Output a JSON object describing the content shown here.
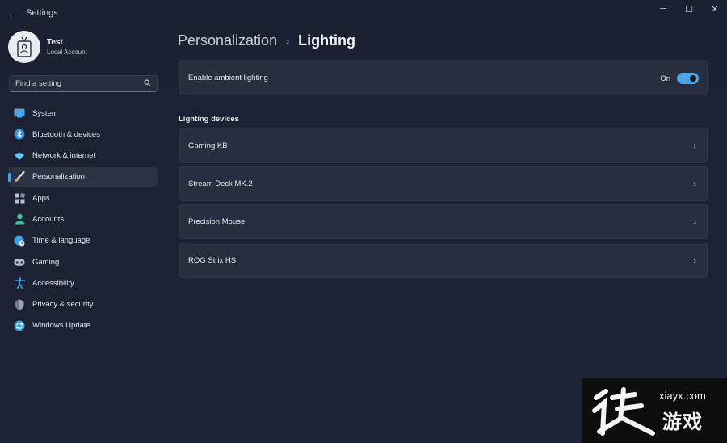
{
  "titlebar": {
    "app_title": "Settings",
    "back_icon": "←",
    "minimize_icon": "─",
    "maximize_icon": "☐",
    "close_icon": "✕"
  },
  "user": {
    "name": "Test",
    "account_type": "Local Account"
  },
  "search": {
    "placeholder": "Find a setting",
    "icon": "⌕"
  },
  "sidebar": {
    "items": [
      {
        "label": "System",
        "icon": "monitor-icon",
        "color": "#4aa6e8",
        "active": false
      },
      {
        "label": "Bluetooth & devices",
        "icon": "bluetooth-icon",
        "color": "#3b8fe0",
        "active": false
      },
      {
        "label": "Network & internet",
        "icon": "wifi-icon",
        "color": "#6cc3f2",
        "active": false
      },
      {
        "label": "Personalization",
        "icon": "brush-icon",
        "color": "#e8a65c",
        "active": true
      },
      {
        "label": "Apps",
        "icon": "apps-icon",
        "color": "#b9c3d3",
        "active": false
      },
      {
        "label": "Accounts",
        "icon": "person-icon",
        "color": "#3fbf9a",
        "active": false
      },
      {
        "label": "Time & language",
        "icon": "globe-clock-icon",
        "color": "#3aa3e6",
        "active": false
      },
      {
        "label": "Gaming",
        "icon": "gamepad-icon",
        "color": "#b9c3d3",
        "active": false
      },
      {
        "label": "Accessibility",
        "icon": "accessibility-icon",
        "color": "#3aa3e6",
        "active": false
      },
      {
        "label": "Privacy & security",
        "icon": "shield-icon",
        "color": "#9aa5b6",
        "active": false
      },
      {
        "label": "Windows Update",
        "icon": "update-icon",
        "color": "#3aa3e6",
        "active": false
      }
    ]
  },
  "breadcrumb": {
    "parent": "Personalization",
    "separator": "›",
    "current": "Lighting"
  },
  "ambient": {
    "label": "Enable ambient lighting",
    "state_label": "On",
    "enabled": true
  },
  "devices": {
    "section_title": "Lighting devices",
    "items": [
      {
        "label": "Gaming KB"
      },
      {
        "label": "Stream Deck MK.2"
      },
      {
        "label": "Precision Mouse"
      },
      {
        "label": "ROG Strix HS"
      }
    ],
    "chevron": "›"
  },
  "watermark": {
    "site": "xiayx.com",
    "text_cn": "游戏"
  },
  "colors": {
    "accent": "#4aa6e8",
    "card": "#272e3d",
    "background": "#1c2232"
  }
}
